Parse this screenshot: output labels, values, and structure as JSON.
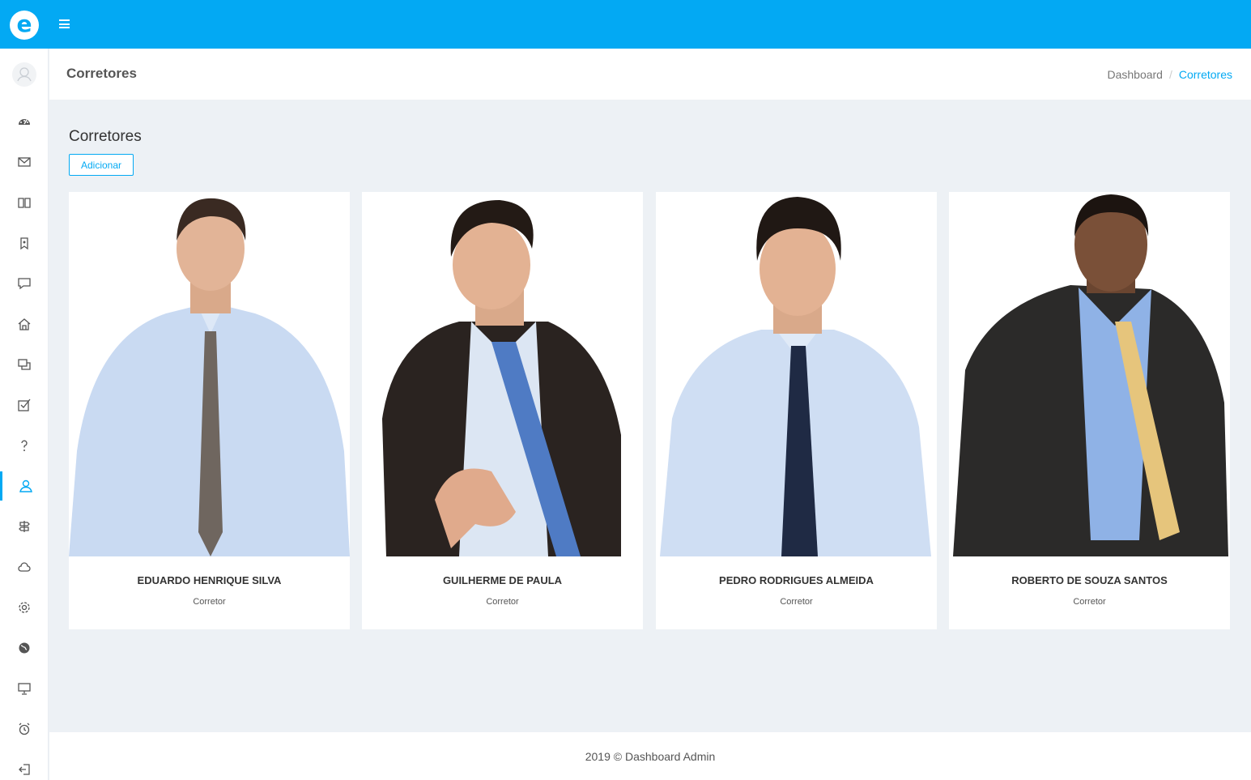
{
  "header": {
    "logo_letter": "e"
  },
  "page": {
    "title": "Corretores"
  },
  "breadcrumb": {
    "home": "Dashboard",
    "separator": "/",
    "current": "Corretores"
  },
  "section": {
    "title": "Corretores",
    "add_label": "Adicionar"
  },
  "sidebar": {
    "items": [
      {
        "icon": "dashboard-icon"
      },
      {
        "icon": "mail-icon"
      },
      {
        "icon": "book-icon"
      },
      {
        "icon": "bookmark-icon"
      },
      {
        "icon": "chat-icon"
      },
      {
        "icon": "home-icon"
      },
      {
        "icon": "windows-icon"
      },
      {
        "icon": "check-square-icon"
      },
      {
        "icon": "question-icon"
      },
      {
        "icon": "user-icon",
        "active": true
      },
      {
        "icon": "signpost-icon"
      },
      {
        "icon": "cloud-icon"
      },
      {
        "icon": "gear-icon"
      },
      {
        "icon": "globe-icon"
      },
      {
        "icon": "presentation-icon"
      },
      {
        "icon": "alarm-icon"
      },
      {
        "icon": "logout-icon"
      }
    ]
  },
  "brokers": [
    {
      "name": "EDUARDO HENRIQUE SILVA",
      "role": "Corretor"
    },
    {
      "name": "GUILHERME DE PAULA",
      "role": "Corretor"
    },
    {
      "name": "PEDRO RODRIGUES ALMEIDA",
      "role": "Corretor"
    },
    {
      "name": "ROBERTO DE SOUZA SANTOS",
      "role": "Corretor"
    }
  ],
  "footer": {
    "text": "2019 © Dashboard Admin"
  },
  "colors": {
    "accent": "#03a9f3",
    "background": "#edf1f5"
  }
}
